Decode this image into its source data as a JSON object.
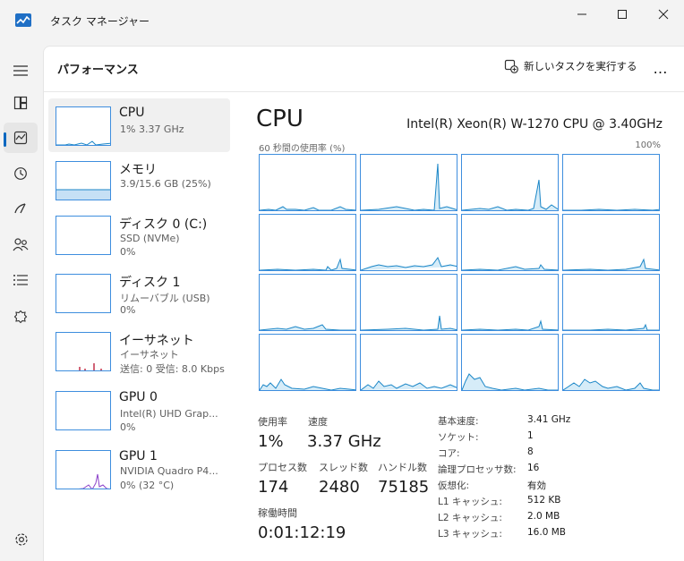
{
  "window": {
    "title": "タスク マネージャー",
    "controls": [
      "minimize",
      "maximize",
      "close"
    ]
  },
  "header": {
    "title": "パフォーマンス",
    "run_new_task": "新しいタスクを実行する",
    "more": "…"
  },
  "nav": {
    "items": [
      "hamburger-icon",
      "processes-icon",
      "performance-icon",
      "app-history-icon",
      "startup-icon",
      "users-icon",
      "details-icon",
      "services-icon"
    ],
    "active": "performance-icon",
    "settings": "settings-icon"
  },
  "resources": [
    {
      "name": "CPU",
      "sub1": "1%  3.37 GHz",
      "sub2": ""
    },
    {
      "name": "メモリ",
      "sub1": "3.9/15.6 GB (25%)",
      "sub2": ""
    },
    {
      "name": "ディスク 0 (C:)",
      "sub1": "SSD (NVMe)",
      "sub2": "0%"
    },
    {
      "name": "ディスク 1",
      "sub1": "リムーバブル (USB)",
      "sub2": "0%"
    },
    {
      "name": "イーサネット",
      "sub1": "イーサネット",
      "sub2": "送信: 0 受信: 8.0 Kbps"
    },
    {
      "name": "GPU 0",
      "sub1": "Intel(R) UHD Grap...",
      "sub2": "0%"
    },
    {
      "name": "GPU 1",
      "sub1": "NVIDIA Quadro P4...",
      "sub2": "0% (32 °C)"
    }
  ],
  "cpu": {
    "title": "CPU",
    "model": "Intel(R) Xeon(R) W-1270 CPU @ 3.40GHz",
    "graph_caption": "60 秒間の使用率 (%)",
    "graph_max": "100%",
    "stats": {
      "utilization_label": "使用率",
      "utilization": "1%",
      "speed_label": "速度",
      "speed": "3.37 GHz",
      "processes_label": "プロセス数",
      "processes": "174",
      "threads_label": "スレッド数",
      "threads": "2480",
      "handles_label": "ハンドル数",
      "handles": "75185",
      "uptime_label": "稼働時間",
      "uptime": "0:01:12:19"
    },
    "specs": [
      {
        "label": "基本速度:",
        "value": "3.41 GHz"
      },
      {
        "label": "ソケット:",
        "value": "1"
      },
      {
        "label": "コア:",
        "value": "8"
      },
      {
        "label": "論理プロセッサ数:",
        "value": "16"
      },
      {
        "label": "仮想化:",
        "value": "有効"
      },
      {
        "label": "L1 キャッシュ:",
        "value": "512 KB"
      },
      {
        "label": "L2 キャッシュ:",
        "value": "2.0 MB"
      },
      {
        "label": "L3 キャッシュ:",
        "value": "16.0 MB"
      }
    ]
  },
  "colors": {
    "cpu_line": "#1a86c7",
    "cpu_fill": "#d6ecf8",
    "mem_fill": "#c6e0f5",
    "net_bar": "#c0304a",
    "gpu_bar": "#8a3fc9",
    "accent": "#0067c0"
  }
}
